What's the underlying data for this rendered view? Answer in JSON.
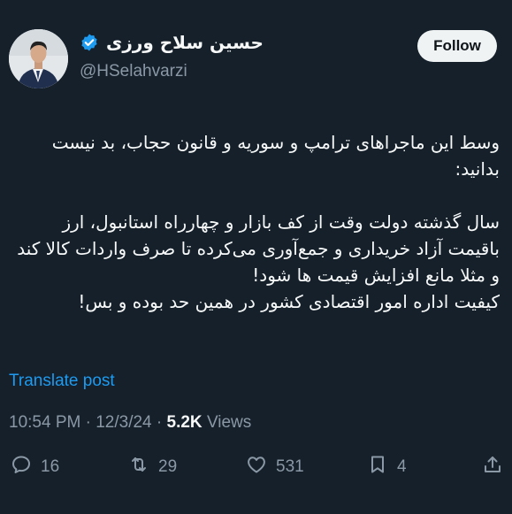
{
  "author": {
    "display_name": "حسین سلاح ورزی",
    "handle": "@HSelahvarzi",
    "avatar_icon": "profile-photo",
    "verified_icon": "verified-badge-icon",
    "verified_color": "#1d9bf0"
  },
  "follow_button": {
    "label": "Follow"
  },
  "tweet": {
    "paragraph1": "وسط این ماجراهای ترامپ و سوریه و قانون حجاب، بد نیست بدانید:",
    "paragraph2": "سال گذشته دولت وقت از کف بازار و چهارراه استانبول، ارز باقیمت آزاد خریداری و جمع‌آوری می‌کرده تا صرف واردات کالا کند و مثلا مانع افزایش قیمت ها شود!",
    "paragraph3": "کیفیت اداره امور اقتصادی کشور در همین حد بوده و بس!"
  },
  "translate": {
    "label": "Translate post",
    "color": "#1d9bf0"
  },
  "meta": {
    "time": "10:54 PM",
    "separator": "·",
    "date": "12/3/24",
    "views_count": "5.2K",
    "views_label": "Views"
  },
  "actions": {
    "replies": "16",
    "reposts": "29",
    "likes": "531",
    "bookmarks": "4"
  },
  "colors": {
    "background": "#15202b",
    "text": "#f7f9f9",
    "muted": "#8b98a5",
    "accent": "#1d9bf0"
  }
}
